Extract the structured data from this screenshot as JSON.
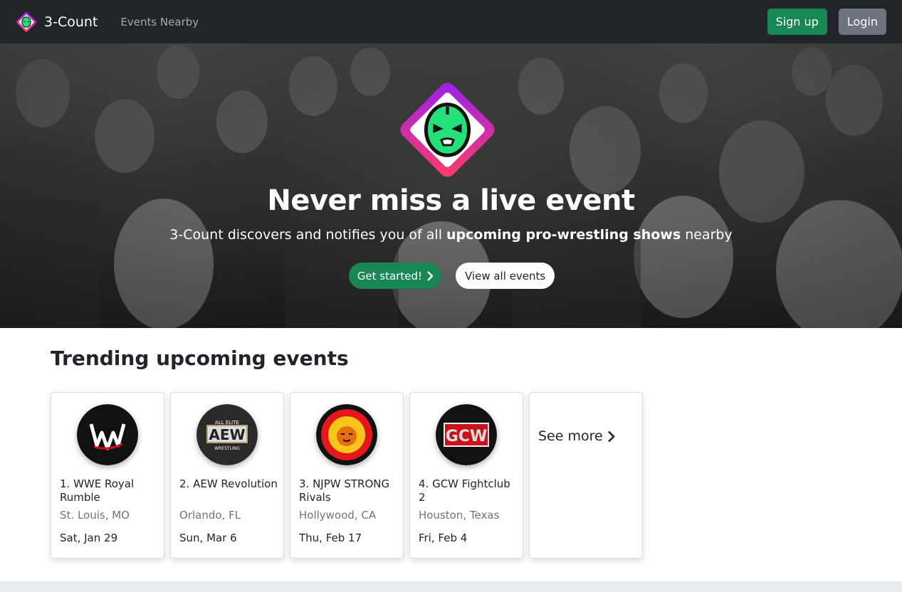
{
  "navbar": {
    "brand": "3-Count",
    "brand_icon": "luchador-mask-icon",
    "events_nearby": "Events Nearby",
    "signup": "Sign up",
    "login": "Login",
    "colors": {
      "bg": "#212529",
      "signup": "#198754",
      "login": "#6c757d"
    }
  },
  "hero": {
    "logo_icon": "luchador-mask-icon",
    "title": "Never miss a live event",
    "subtitle_pre": "3-Count discovers and notifies you of all ",
    "subtitle_bold": "upcoming pro-wrestling shows",
    "subtitle_post": " nearby",
    "get_started": "Get started!",
    "view_all": "View all events"
  },
  "trending": {
    "title": "Trending upcoming events",
    "events": [
      {
        "name": "1. WWE Royal Rumble",
        "location": "St. Louis, MO",
        "date": "Sat, Jan 29",
        "logo_icon": "wwe-logo-icon"
      },
      {
        "name": "2. AEW Revolution",
        "location": "Orlando, FL",
        "date": "Sun, Mar 6",
        "logo_icon": "aew-logo-icon"
      },
      {
        "name": "3. NJPW STRONG Rivals",
        "location": "Hollywood, CA",
        "date": "Thu, Feb 17",
        "logo_icon": "njpw-logo-icon"
      },
      {
        "name": "4. GCW Fightclub 2",
        "location": "Houston, Texas",
        "date": "Fri, Feb 4",
        "logo_icon": "gcw-logo-icon"
      }
    ],
    "see_more": "See more"
  },
  "logo_text": {
    "aew_top": "ALL ELITE",
    "aew_main": "AEW",
    "aew_bottom": "WRESTLING",
    "gcw": "GCW"
  }
}
